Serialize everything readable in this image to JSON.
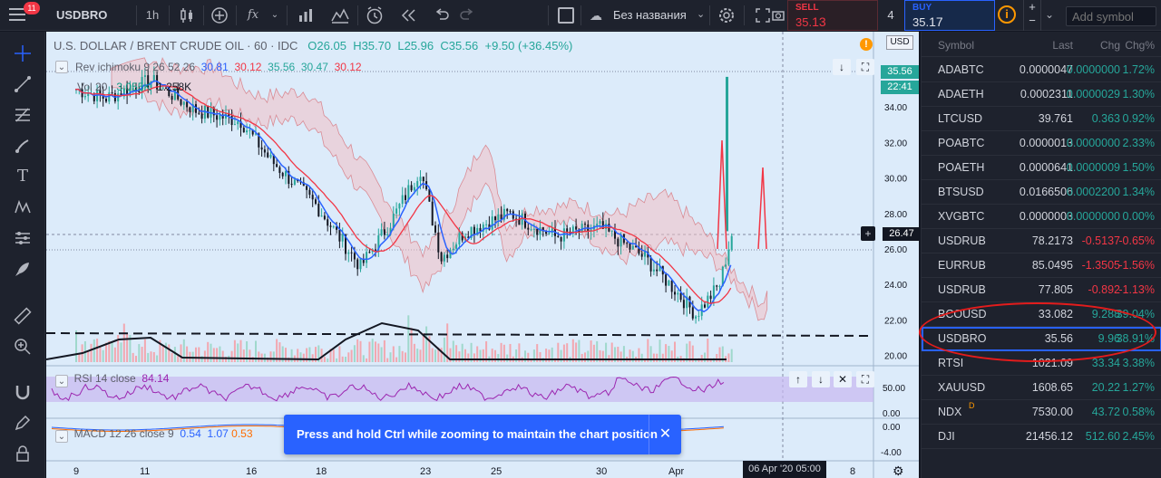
{
  "toolbar": {
    "notification_count": "11",
    "symbol": "USDBRO",
    "interval": "1h",
    "fx_label": "fx",
    "layout_name": "Без названия",
    "sell_label": "SELL",
    "sell_price_main": "35.",
    "sell_price_pip": "13",
    "spread": "4",
    "buy_label": "BUY",
    "buy_price_main": "35.",
    "buy_price_pip": "17",
    "add_symbol_placeholder": "Add symbol",
    "info": "i"
  },
  "chart": {
    "title_prefix": "U.S. DOLLAR / BRENT CRUDE OIL · 60 · IDC",
    "open": "O26.05",
    "high": "H35.70",
    "low": "L25.96",
    "close": "C35.56",
    "change": "+9.50 (+36.45%)",
    "ichimoku_label": "Rev ichimoku 9 26 52 26",
    "ichimoku_v1": "30.81",
    "ichimoku_v2": "30.12",
    "ichimoku_v3": "35.56",
    "ichimoku_v4": "30.47",
    "ichimoku_v5": "30.12",
    "vol_label": "Vol 20",
    "vol_v1": "3.055K",
    "vol_v2": "1.258K",
    "rsi_label": "RSI 14 close",
    "rsi_value": "84.14",
    "macd_label": "MACD 12 26 close 9",
    "macd_v1": "0.54",
    "macd_v2": "1.07",
    "macd_v3": "0.53",
    "currency": "USD",
    "last_price_tag": "35.56",
    "countdown_tag": "22:41",
    "crosshair_price": "26.47",
    "date_tag": "06 Apr '20  05:00",
    "alert_marker": "!",
    "price_axis": [
      "36.00",
      "34.00",
      "32.00",
      "30.00",
      "28.00",
      "26.00",
      "24.00",
      "22.00",
      "20.00"
    ],
    "rsi_axis": [
      "50.00",
      "0.00"
    ],
    "macd_axis": [
      "0.00",
      "-4.00"
    ],
    "time_axis": [
      "9",
      "11",
      "16",
      "18",
      "23",
      "25",
      "30",
      "Apr",
      "8"
    ]
  },
  "toast": {
    "message": "Press and hold Ctrl while zooming to maintain the chart position",
    "close": "✕"
  },
  "watchlist": {
    "headers": {
      "symbol": "Symbol",
      "last": "Last",
      "chg": "Chg",
      "chg_pct": "Chg%"
    },
    "rows": [
      {
        "symbol": "ADABTC",
        "last": "0.0000047",
        "chg": "0.0000000",
        "chg_pct": "1.72%",
        "dir": "pos"
      },
      {
        "symbol": "ADAETH",
        "last": "0.0002311",
        "chg": "0.0000029",
        "chg_pct": "1.30%",
        "dir": "pos"
      },
      {
        "symbol": "LTCUSD",
        "last": "39.761",
        "chg": "0.363",
        "chg_pct": "0.92%",
        "dir": "pos"
      },
      {
        "symbol": "POABTC",
        "last": "0.0000013",
        "chg": "0.0000000",
        "chg_pct": "2.33%",
        "dir": "pos"
      },
      {
        "symbol": "POAETH",
        "last": "0.0000641",
        "chg": "0.0000009",
        "chg_pct": "1.50%",
        "dir": "pos"
      },
      {
        "symbol": "BTSUSD",
        "last": "0.0166506",
        "chg": "0.0002200",
        "chg_pct": "1.34%",
        "dir": "pos"
      },
      {
        "symbol": "XVGBTC",
        "last": "0.0000003",
        "chg": "0.0000000",
        "chg_pct": "0.00%",
        "dir": "pos"
      },
      {
        "symbol": "USDRUB",
        "last": "78.2173",
        "chg": "-0.5137",
        "chg_pct": "-0.65%",
        "dir": "neg"
      },
      {
        "symbol": "EURRUB",
        "last": "85.0495",
        "chg": "-1.3505",
        "chg_pct": "-1.56%",
        "dir": "neg"
      },
      {
        "symbol": "USDRUB",
        "last": "77.805",
        "chg": "-0.892",
        "chg_pct": "-1.13%",
        "dir": "neg"
      },
      {
        "symbol": "BCOUSD",
        "last": "33.082",
        "chg": "9.288",
        "chg_pct": "39.04%",
        "dir": "pos"
      },
      {
        "symbol": "USDBRO",
        "last": "35.56",
        "chg": "9.96",
        "chg_pct": "38.91%",
        "dir": "pos"
      },
      {
        "symbol": "RTSI",
        "last": "1021.09",
        "chg": "33.34",
        "chg_pct": "3.38%",
        "dir": "pos"
      },
      {
        "symbol": "XAUUSD",
        "last": "1608.65",
        "chg": "20.22",
        "chg_pct": "1.27%",
        "dir": "pos"
      },
      {
        "symbol": "NDX",
        "last": "7530.00",
        "chg": "43.72",
        "chg_pct": "0.58%",
        "dir": "pos",
        "badge": "D"
      },
      {
        "symbol": "DJI",
        "last": "21456.12",
        "chg": "512.60",
        "chg_pct": "2.45%",
        "dir": "pos"
      }
    ]
  },
  "colors": {
    "up": "#26a69a",
    "down": "#f23645",
    "accent": "#2962ff",
    "chart_bg": "#dcebfa",
    "cloud_red": "#f2bfc5",
    "cloud_green": "#bfe3c4"
  }
}
